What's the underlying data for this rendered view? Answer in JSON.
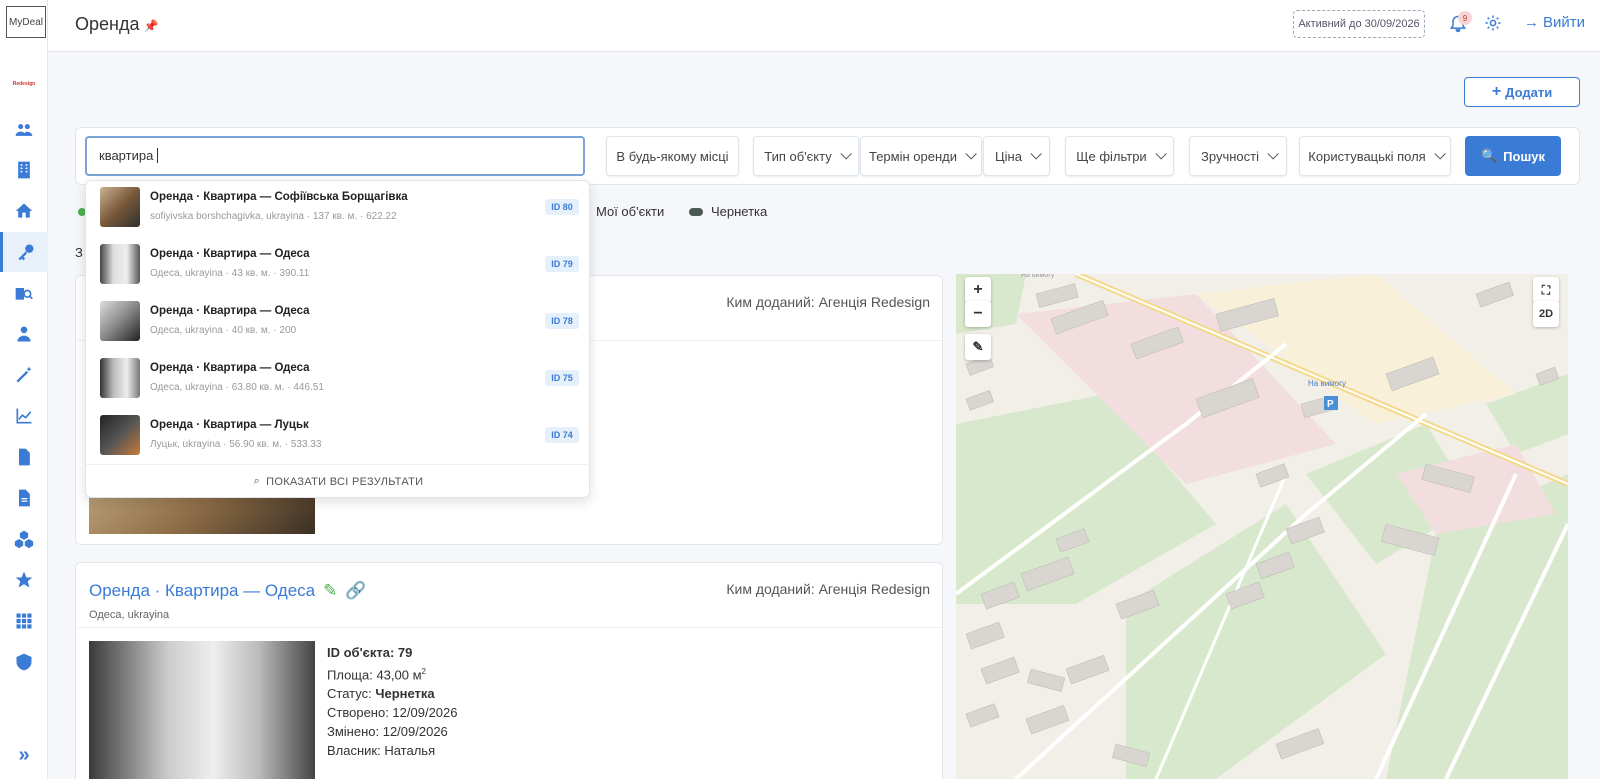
{
  "app": {
    "logo_text": "MyDeal",
    "brand_text": "Redesign",
    "page_title": "Оренда"
  },
  "header": {
    "active_badge": "Активний до 30/09/2026",
    "notifications_count": "9",
    "logout_label": "Вийти"
  },
  "toolbar": {
    "add_label": "Додати"
  },
  "search": {
    "value": "квартира",
    "location_label": "В будь-якому місці",
    "filters": [
      "Тип об'єкту",
      "Термін оренди",
      "Ціна",
      "Ще фільтри",
      "Зручності",
      "Користувацькі поля"
    ],
    "search_label": "Пошук"
  },
  "legend": {
    "my_objects": "Мої об'єкти",
    "draft": "Чернетка",
    "truncated_text": "З"
  },
  "dropdown": {
    "items": [
      {
        "title": "Оренда · Квартира — Софіївська Борщагівка",
        "sub": "sofiyivska borshchagivka, ukrayina · 137 кв. м. · 622.22",
        "id": "ID 80"
      },
      {
        "title": "Оренда · Квартира — Одеса",
        "sub": "Одеса, ukrayina · 43 кв. м. · 390.11",
        "id": "ID 79"
      },
      {
        "title": "Оренда · Квартира — Одеса",
        "sub": "Одеса, ukrayina · 40 кв. м. · 200",
        "id": "ID 78"
      },
      {
        "title": "Оренда · Квартира — Одеса",
        "sub": "Одеса, ukrayina · 63.80 кв. м. · 446.51",
        "id": "ID 75"
      },
      {
        "title": "Оренда · Квартира — Луцьк",
        "sub": "Луцьк, ukrayina · 56.90 кв. м. · 533.33",
        "id": "ID 74"
      }
    ],
    "show_all": "ПОКАЗАТИ ВСІ РЕЗУЛЬТАТИ"
  },
  "cards": [
    {
      "added_by": "Ким доданий: Агенція Redesign"
    },
    {
      "title": "Оренда · Квартира — Одеса",
      "sub": "Одеса, ukrayina",
      "added_by": "Ким доданий: Агенція Redesign",
      "id_label": "ID об'єкта: 79",
      "area": "Площа: 43,00 м",
      "area_sup": "2",
      "status_label": "Статус:",
      "status_value": "Чернетка",
      "created": "Створено: 12/09/2026",
      "modified": "Змінено: 12/09/2026",
      "owner": "Власник: Наталья"
    }
  ],
  "map": {
    "zoom_in": "+",
    "zoom_out": "−",
    "mode": "2D",
    "labels": [
      "На вимогу",
      "P"
    ],
    "colors": {
      "land": "#f2efe9",
      "park": "#d8e8cc",
      "road": "#ffffff",
      "zone": "#f2dede",
      "building": "#d9d6d2"
    }
  },
  "colors": {
    "accent": "#3a7bd5",
    "draft": "#4a5b56"
  }
}
